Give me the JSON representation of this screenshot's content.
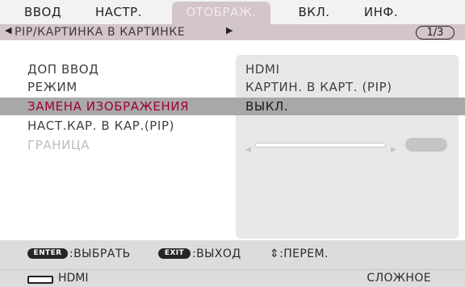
{
  "tabs": [
    {
      "label": "ВВОД",
      "active": false
    },
    {
      "label": "НАСТР.",
      "active": false
    },
    {
      "label": "ОТОБРАЖ.",
      "active": true
    },
    {
      "label": "ВКЛ.",
      "active": false
    },
    {
      "label": "ИНФ.",
      "active": false
    }
  ],
  "submenu": {
    "left_arrow": "◀",
    "title": "PIP/КАРТИНКА В КАРТИНКЕ",
    "right_arrow": "▶",
    "pager": "1/3"
  },
  "rows": [
    {
      "label": "ДОП ВВОД",
      "value": "HDMI",
      "selected": false,
      "disabled": false
    },
    {
      "label": "РЕЖИМ",
      "value": "КАРТИН. В КАРТ. (PIP)",
      "selected": false,
      "disabled": false
    },
    {
      "label": "ЗАМЕНА ИЗОБРАЖЕНИЯ",
      "value": "ВЫКЛ.",
      "selected": true,
      "disabled": false
    },
    {
      "label": "НАСТ.КАР. В КАР.(PIP)",
      "value": "",
      "selected": false,
      "disabled": false
    },
    {
      "label": "ГРАНИЦА",
      "value": "",
      "selected": false,
      "disabled": true
    }
  ],
  "slider": {
    "left_arrow": "◀",
    "right_arrow": "▶"
  },
  "hints": {
    "enter_key": "ENTER",
    "enter_label": ":ВЫБРАТЬ",
    "exit_key": "EXIT",
    "exit_label": ":ВЫХОД",
    "move_label": "⇕:ПЕРЕМ."
  },
  "status": {
    "source": "HDMI",
    "mode": "СЛОЖНОЕ"
  },
  "colors": {
    "active_tab_bg": "#d4c4cc",
    "selected_row_bg": "#a8a8a8",
    "selected_label_text": "#a00030"
  }
}
